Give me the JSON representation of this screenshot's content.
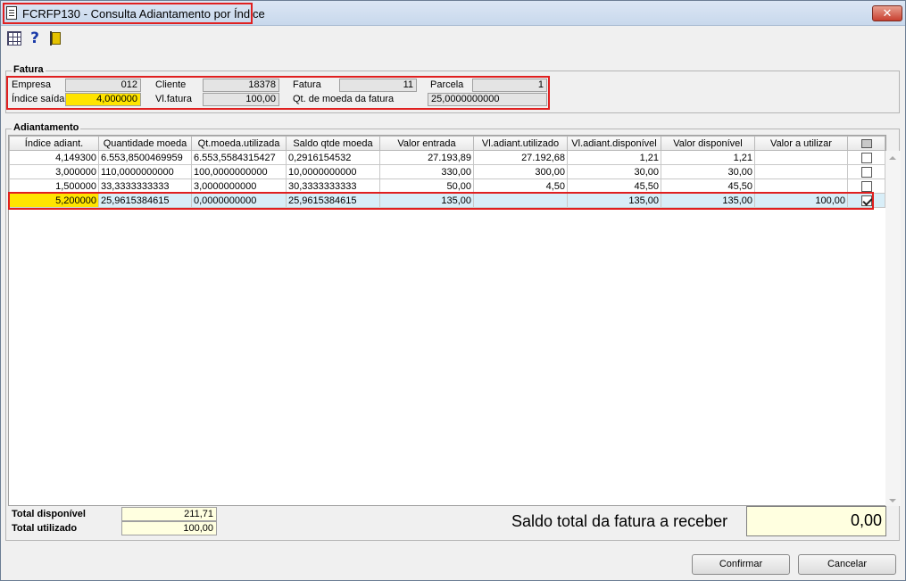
{
  "window": {
    "title": "FCRFP130 - Consulta Adiantamento por Índice",
    "close_label": "✕"
  },
  "toolbar": {
    "help_label": "?"
  },
  "fatura": {
    "group_label": "Fatura",
    "empresa_label": "Empresa",
    "empresa_value": "012",
    "cliente_label": "Cliente",
    "cliente_value": "18378",
    "fatura_label": "Fatura",
    "fatura_value": "11",
    "parcela_label": "Parcela",
    "parcela_value": "1",
    "indice_saida_label": "Índice saída",
    "indice_saida_value": "4,000000",
    "vl_fatura_label": "Vl.fatura",
    "vl_fatura_value": "100,00",
    "qt_moeda_label": "Qt. de moeda da fatura",
    "qt_moeda_value": "25,0000000000"
  },
  "adiantamento": {
    "group_label": "Adiantamento",
    "columns": [
      "Índice adiant.",
      "Quantidade moeda",
      "Qt.moeda.utilizada",
      "Saldo qtde moeda",
      "Valor entrada",
      "Vl.adiant.utilizado",
      "Vl.adiant.disponível",
      "Valor disponível",
      "Valor a utilizar"
    ],
    "rows": [
      [
        "4,149300",
        "6.553,8500469959",
        "6.553,5584315427",
        "0,2916154532",
        "27.193,89",
        "27.192,68",
        "1,21",
        "1,21",
        ""
      ],
      [
        "3,000000",
        "110,0000000000",
        "100,0000000000",
        "10,0000000000",
        "330,00",
        "300,00",
        "30,00",
        "30,00",
        ""
      ],
      [
        "1,500000",
        "33,3333333333",
        "3,0000000000",
        "30,3333333333",
        "50,00",
        "4,50",
        "45,50",
        "45,50",
        ""
      ],
      [
        "5,200000",
        "25,9615384615",
        "0,0000000000",
        "25,9615384615",
        "135,00",
        "",
        "135,00",
        "135,00",
        "100,00"
      ]
    ],
    "checked": [
      false,
      false,
      false,
      true
    ]
  },
  "totals": {
    "disponivel_label": "Total disponível",
    "disponivel_value": "211,71",
    "utilizado_label": "Total utilizado",
    "utilizado_value": "100,00",
    "saldo_label": "Saldo total da fatura a receber",
    "saldo_value": "0,00"
  },
  "buttons": {
    "confirm": "Confirmar",
    "cancel": "Cancelar"
  },
  "colors": {
    "highlight": "#ffe400",
    "annotation_red": "#e02020",
    "selected_row": "#d8eef8"
  }
}
